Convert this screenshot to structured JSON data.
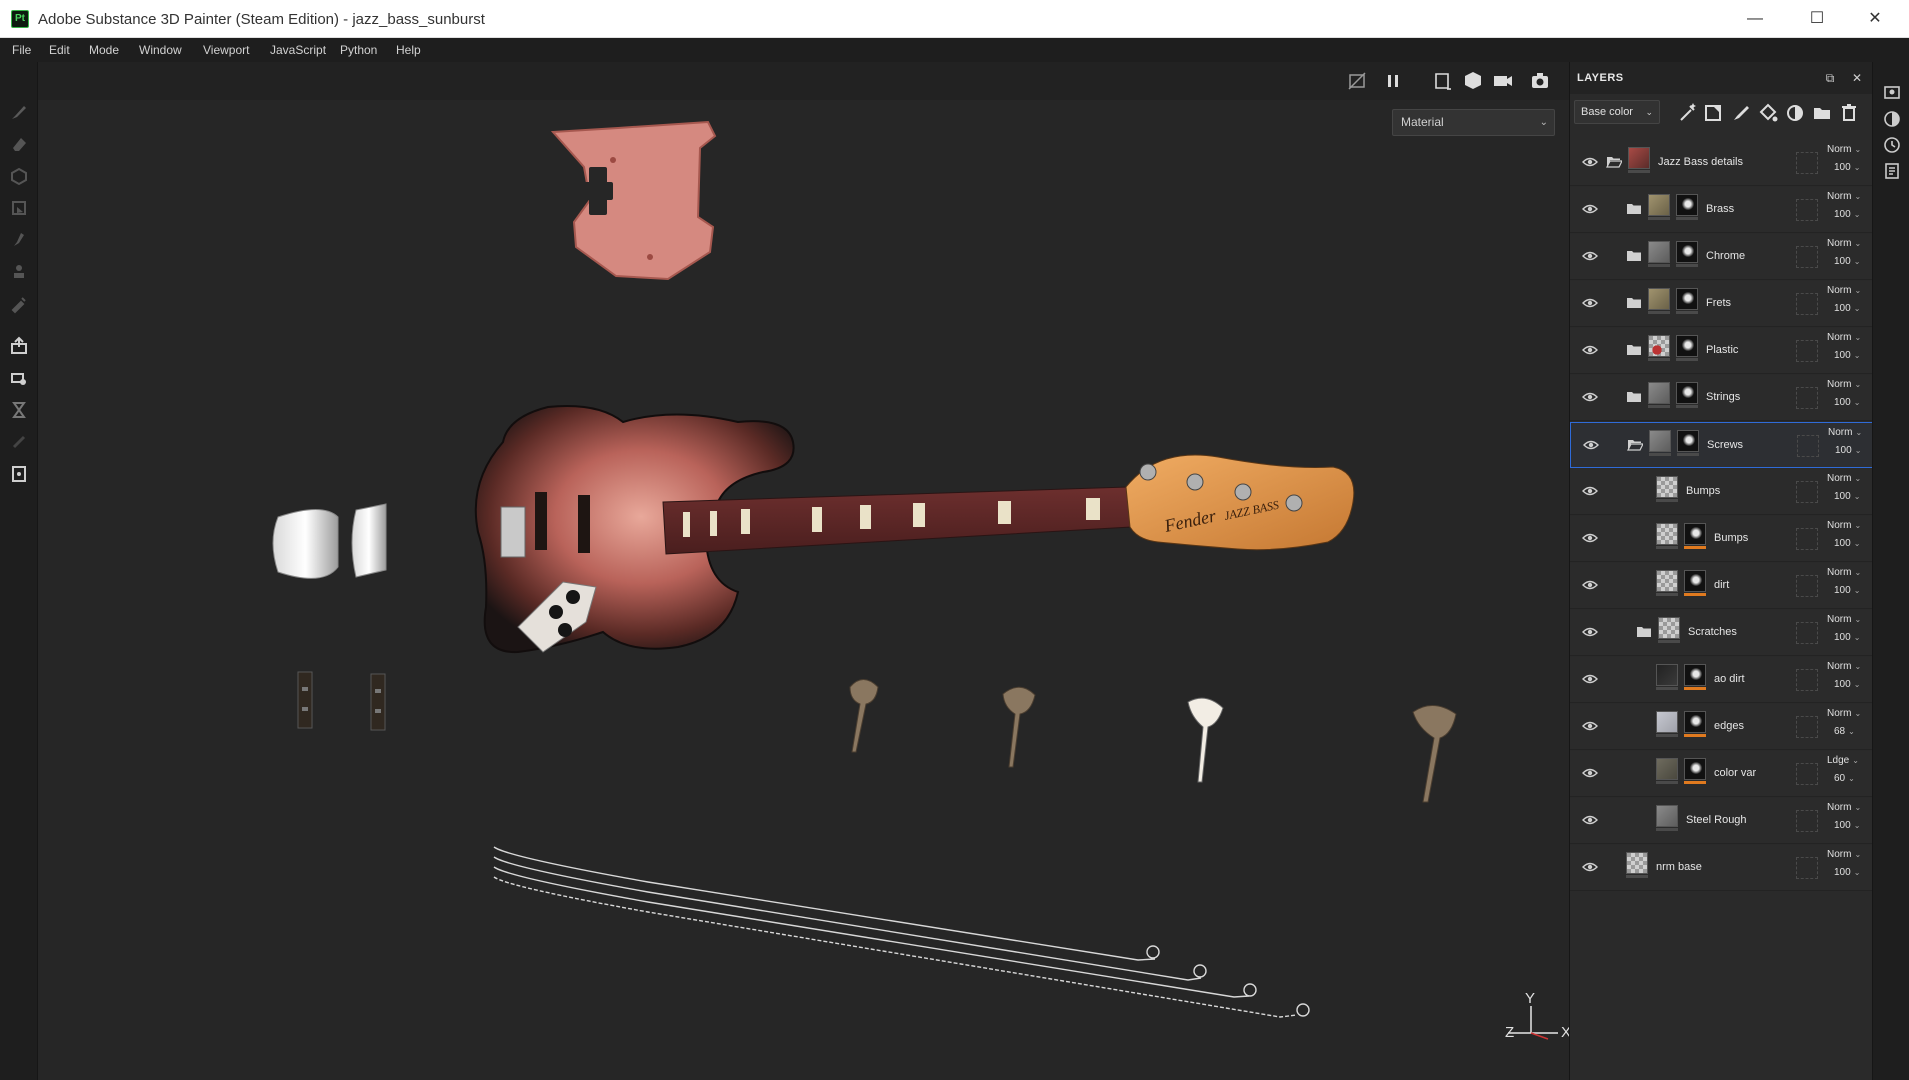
{
  "window": {
    "title": "Adobe Substance 3D Painter (Steam Edition) - jazz_bass_sunburst",
    "app_icon_text": "Pt",
    "minimize": "—",
    "maximize": "☐",
    "close": "✕"
  },
  "menu": [
    "File",
    "Edit",
    "Mode",
    "Window",
    "Viewport",
    "JavaScript",
    "Python",
    "Help"
  ],
  "viewport": {
    "material_mode": "Material",
    "gizmo": {
      "x": "X",
      "y": "Y",
      "z": "Z"
    }
  },
  "layers_panel": {
    "title": "LAYERS",
    "channel": "Base color",
    "layers": [
      {
        "name": "Jazz Bass details",
        "blend": "Norm",
        "opacity": "100",
        "type": "folder-open",
        "level": 0,
        "thumb": "red",
        "mask": false,
        "bar": "gray"
      },
      {
        "name": "Brass",
        "blend": "Norm",
        "opacity": "100",
        "type": "folder",
        "level": 1,
        "thumb": "tan",
        "mask": true,
        "bar": "gray"
      },
      {
        "name": "Chrome",
        "blend": "Norm",
        "opacity": "100",
        "type": "folder",
        "level": 1,
        "thumb": "gray",
        "mask": true,
        "bar": "gray"
      },
      {
        "name": "Frets",
        "blend": "Norm",
        "opacity": "100",
        "type": "folder",
        "level": 1,
        "thumb": "tan",
        "mask": true,
        "bar": "gray"
      },
      {
        "name": "Plastic",
        "blend": "Norm",
        "opacity": "100",
        "type": "folder",
        "level": 1,
        "thumb": "checker-red",
        "mask": true,
        "bar": "gray"
      },
      {
        "name": "Strings",
        "blend": "Norm",
        "opacity": "100",
        "type": "folder",
        "level": 1,
        "thumb": "gray",
        "mask": true,
        "bar": "gray"
      },
      {
        "name": "Screws",
        "blend": "Norm",
        "opacity": "100",
        "type": "folder-open",
        "level": 1,
        "thumb": "gray",
        "mask": true,
        "bar": "gray",
        "selected": true
      },
      {
        "name": "Bumps",
        "blend": "Norm",
        "opacity": "100",
        "type": "fill",
        "level": 2,
        "thumb": "checker",
        "mask": false,
        "bar": "gray"
      },
      {
        "name": "Bumps",
        "blend": "Norm",
        "opacity": "100",
        "type": "fill",
        "level": 2,
        "thumb": "checker",
        "mask": true,
        "bar": "orange"
      },
      {
        "name": "dirt",
        "blend": "Norm",
        "opacity": "100",
        "type": "fill",
        "level": 2,
        "thumb": "checker",
        "mask": true,
        "bar": "orange"
      },
      {
        "name": "Scratches",
        "blend": "Norm",
        "opacity": "100",
        "type": "folder",
        "level": 2,
        "thumb": "checker",
        "mask": false,
        "bar": "gray"
      },
      {
        "name": "ao dirt",
        "blend": "Norm",
        "opacity": "100",
        "type": "fill",
        "level": 2,
        "thumb": "dark",
        "mask": true,
        "bar": "orange"
      },
      {
        "name": "edges",
        "blend": "Norm",
        "opacity": "68",
        "type": "fill",
        "level": 2,
        "thumb": "light",
        "mask": true,
        "bar": "orange"
      },
      {
        "name": "color var",
        "blend": "Ldge",
        "opacity": "60",
        "type": "fill",
        "level": 2,
        "thumb": "olive",
        "mask": true,
        "bar": "orange"
      },
      {
        "name": "Steel Rough",
        "blend": "Norm",
        "opacity": "100",
        "type": "fill",
        "level": 2,
        "thumb": "gray",
        "mask": false,
        "bar": "gray"
      },
      {
        "name": "nrm base",
        "blend": "Norm",
        "opacity": "100",
        "type": "fill",
        "level": 0,
        "thumb": "checker",
        "mask": false,
        "bar": "gray"
      }
    ]
  },
  "colors": {
    "selection": "#2f6bd8",
    "mask_bar": "#e07a1f",
    "panel_bg": "#2a2a2a",
    "viewport_bg": "#262626"
  }
}
